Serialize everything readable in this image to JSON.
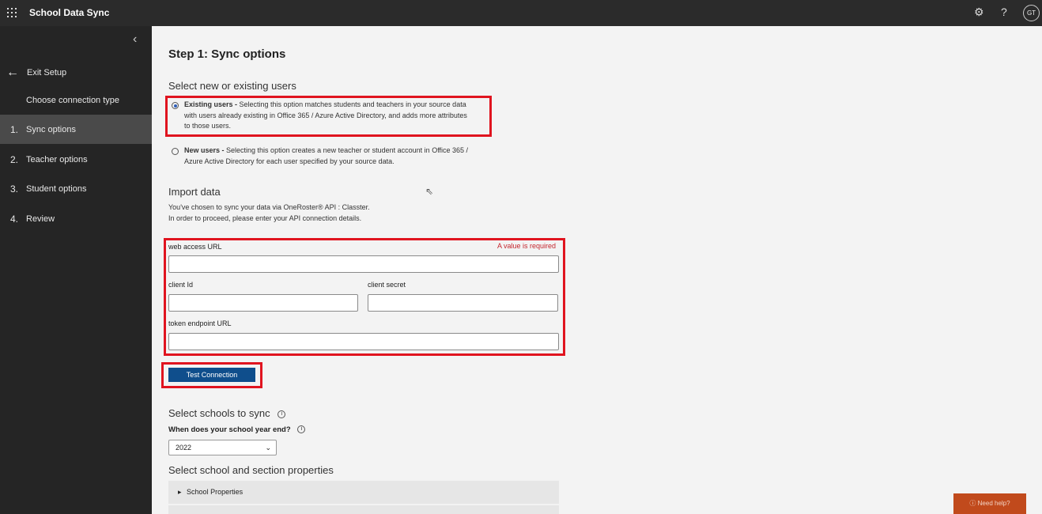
{
  "app": {
    "title": "School Data Sync",
    "avatar_initials": "GT"
  },
  "topbar": {
    "settings_icon": "gear-icon",
    "help_icon": "question-icon"
  },
  "sidebar": {
    "exit_label": "Exit Setup",
    "connection_label": "Choose connection type",
    "steps": [
      {
        "num": "1.",
        "label": "Sync options",
        "active": true
      },
      {
        "num": "2.",
        "label": "Teacher options",
        "active": false
      },
      {
        "num": "3.",
        "label": "Student options",
        "active": false
      },
      {
        "num": "4.",
        "label": "Review",
        "active": false
      }
    ]
  },
  "main": {
    "title": "Step 1: Sync options",
    "users_heading": "Select new or existing users",
    "existing_users": {
      "label": "Existing users -",
      "desc1": " Selecting this option matches students and teachers in your source data",
      "desc2": "with users already existing in Office 365 / Azure Active Directory, and adds more attributes",
      "desc3": "to those users.",
      "selected": true
    },
    "new_users": {
      "label": "New users -",
      "desc1": " Selecting this option creates a new teacher or student account in Office 365 /",
      "desc2": "Azure Active Directory for each user specified by your source data.",
      "selected": false
    },
    "import_heading": "Import data",
    "import_desc1": "You've chosen to sync your data via OneRoster® API : Classter.",
    "import_desc2": "In order to proceed, please enter your API connection details.",
    "fields": {
      "web_access_url": {
        "label": "web access URL",
        "value": "",
        "error": "A value is required"
      },
      "client_id": {
        "label": "client Id",
        "value": ""
      },
      "client_secret": {
        "label": "client secret",
        "value": ""
      },
      "token_endpoint_url": {
        "label": "token endpoint URL",
        "value": ""
      }
    },
    "test_button": "Test Connection",
    "schools_heading": "Select schools to sync",
    "year_end_label": "When does your school year end?",
    "year_end_value": "2022",
    "properties_heading": "Select school and section properties",
    "school_properties": "School Properties"
  },
  "help_button": "Need help?"
}
